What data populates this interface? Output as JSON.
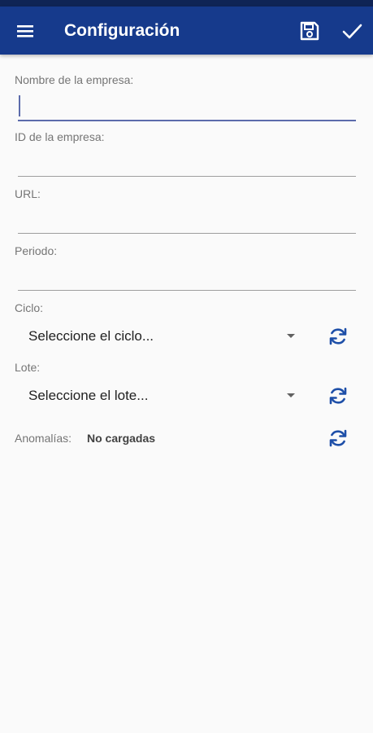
{
  "colors": {
    "app_bar": "#163a8c",
    "status_bar": "#0f2455",
    "accent": "#5c6bab",
    "refresh_icon": "#1e4fa8",
    "background": "#fafafa"
  },
  "app_bar": {
    "title": "Configuración",
    "menu_icon": "hamburger-menu",
    "save_icon": "floppy-disk",
    "confirm_icon": "checkmark"
  },
  "form": {
    "company_name": {
      "label": "Nombre de la empresa:",
      "value": ""
    },
    "company_id": {
      "label": "ID de la empresa:",
      "value": ""
    },
    "url": {
      "label": "URL:",
      "value": ""
    },
    "period": {
      "label": "Periodo:",
      "value": ""
    },
    "cycle": {
      "label": "Ciclo:",
      "selected": "Seleccione el ciclo..."
    },
    "batch": {
      "label": "Lote:",
      "selected": "Seleccione el lote..."
    },
    "anomalies": {
      "label": "Anomalías:",
      "status": "No cargadas"
    }
  },
  "icons": {
    "dropdown": "caret-down",
    "refresh": "refresh-arrows"
  }
}
